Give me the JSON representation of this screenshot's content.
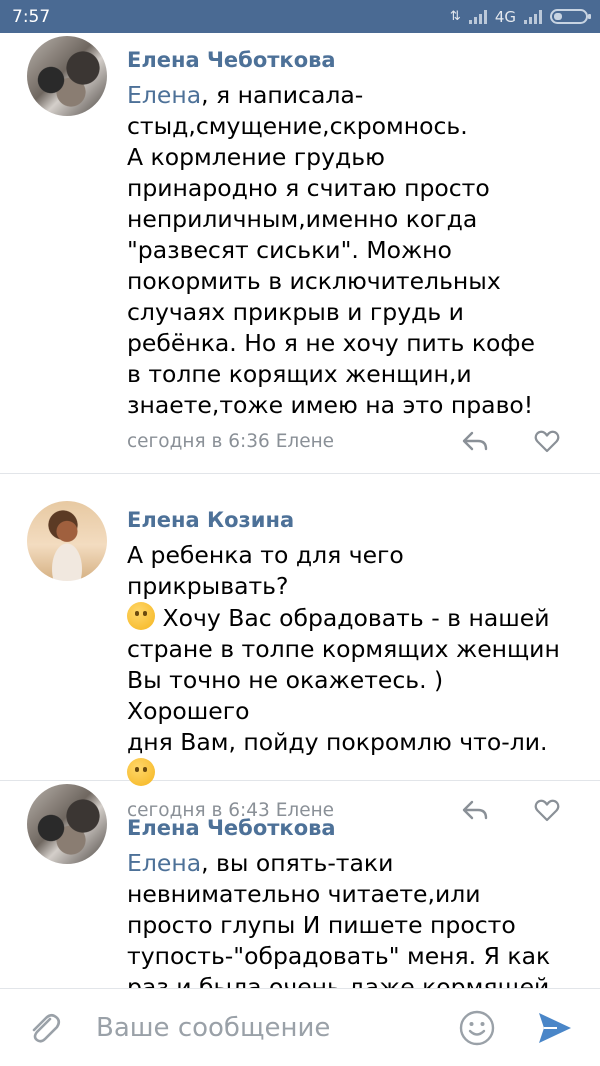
{
  "status_bar": {
    "time": "7:57",
    "network": "4G",
    "icons": [
      "data-arrows-icon",
      "signal-icon",
      "signal-icon",
      "battery-icon"
    ]
  },
  "comments": [
    {
      "author": "Елена Чеботкова",
      "mention": "Елена",
      "text": ", я написала-\nстыд,смущение,скромнось.\nА кормление грудью\nпринародно я считаю просто\nнеприличным,именно когда\n\"развесят сиськи\". Можно\nпокормить в исключительных\nслучаях прикрыв и грудь и\nребёнка. Но я не хочу пить кофе\nв толпе корящих женщин,и\nзнаете,тоже имею на это право!",
      "meta": "сегодня в 6:36 Елене"
    },
    {
      "author": "Елена Козина",
      "text_part1": "А ребенка то для чего прикрывать?\n",
      "text_part2": " Хочу Вас обрадовать - в нашей\nстране в толпе кормящих женщин\nВы точно не окажетесь. ) Хорошего\nдня Вам, пойду покромлю что-ли.\n",
      "emojis": [
        "thinking-face-emoji",
        "winking-face-emoji"
      ],
      "meta": "сегодня в 6:43 Елене"
    },
    {
      "author": "Елена Чеботкова",
      "mention": "Елена",
      "text": ", вы опять-таки\nневнимательно читаете,или\nпросто глупы И пишете просто\nтупость-\"обрадовать\" меня. Я как\nраз и была очень даже кормящей"
    }
  ],
  "composer": {
    "placeholder": "Ваше сообщение"
  },
  "colors": {
    "status_bar": "#4a6a93",
    "accent": "#4d7198",
    "meta": "#8a9097",
    "send": "#4a86c8"
  }
}
